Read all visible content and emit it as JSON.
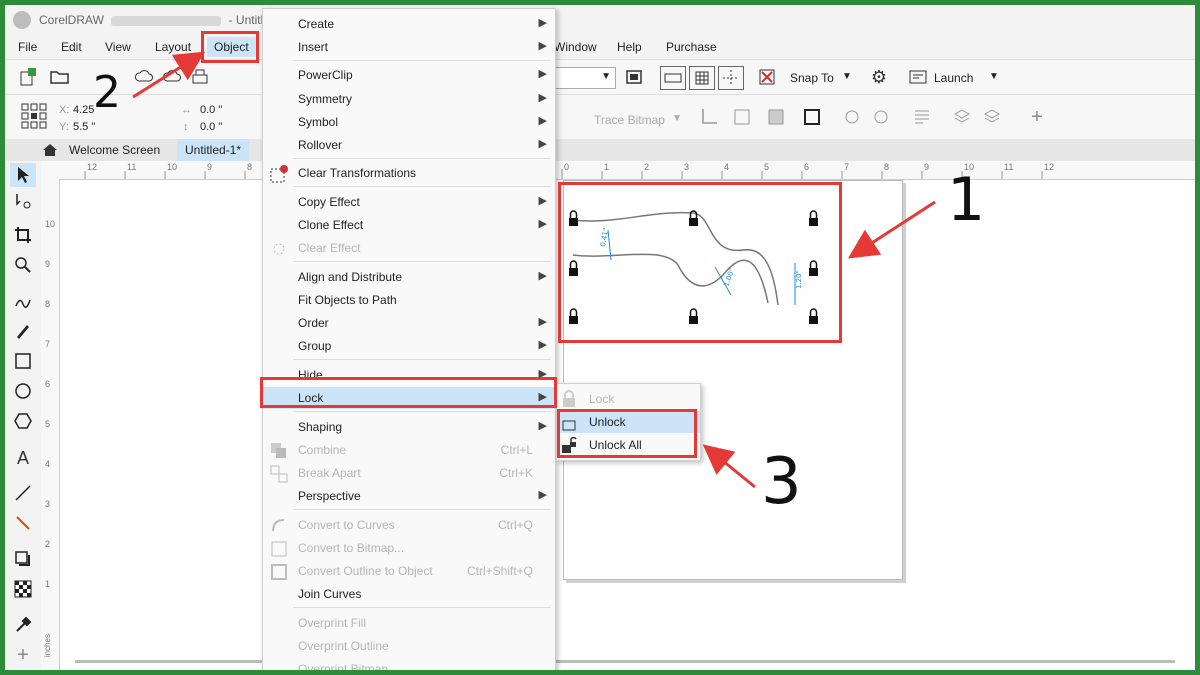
{
  "window": {
    "app_title": "CorelDRAW",
    "title_suffix": "- Untitled"
  },
  "menubar": [
    "File",
    "Edit",
    "View",
    "Layout",
    "Object",
    "Window",
    "Help",
    "Purchase"
  ],
  "toolbar": {
    "snap_to": "Snap To",
    "launch": "Launch",
    "trace_bitmap": "Trace Bitmap"
  },
  "property_bar": {
    "x": "4.25",
    "y": "5.5 \"",
    "w": "0.0 \"",
    "h": "0.0 \""
  },
  "tabs": {
    "welcome": "Welcome Screen",
    "doc": "Untitled-1*"
  },
  "ruler_top_labels": [
    "12",
    "11",
    "10",
    "9",
    "8",
    "0",
    "1",
    "2",
    "3",
    "4",
    "5",
    "6",
    "7",
    "8",
    "9",
    "10",
    "11",
    "12"
  ],
  "ruler_left_labels": [
    "10",
    "9",
    "8",
    "7",
    "6",
    "5",
    "4",
    "3",
    "2",
    "1"
  ],
  "ruler_unit": "inches",
  "object_menu": {
    "create": "Create",
    "insert": "Insert",
    "powerclip": "PowerClip",
    "symmetry": "Symmetry",
    "symbol": "Symbol",
    "rollover": "Rollover",
    "clear_transformations": "Clear Transformations",
    "copy_effect": "Copy Effect",
    "clone_effect": "Clone Effect",
    "clear_effect": "Clear Effect",
    "align": "Align and Distribute",
    "fit_path": "Fit Objects to Path",
    "order": "Order",
    "group": "Group",
    "hide": "Hide",
    "lock": "Lock",
    "shaping": "Shaping",
    "combine": "Combine",
    "combine_sc": "Ctrl+L",
    "break_apart": "Break Apart",
    "break_apart_sc": "Ctrl+K",
    "perspective": "Perspective",
    "convert_curves": "Convert to Curves",
    "convert_curves_sc": "Ctrl+Q",
    "convert_bitmap": "Convert to Bitmap...",
    "convert_outline": "Convert Outline to Object",
    "convert_outline_sc": "Ctrl+Shift+Q",
    "join_curves": "Join Curves",
    "overprint_fill": "Overprint Fill",
    "overprint_outline": "Overprint Outline",
    "overprint_bitmap": "Overprint Bitmap"
  },
  "lock_submenu": {
    "lock": "Lock",
    "unlock": "Unlock",
    "unlock_all": "Unlock All"
  },
  "dimensions": {
    "d1": "0.41\"",
    "d2": "1.00\"",
    "d3": "1.20\""
  },
  "annotations": {
    "one": "1",
    "two": "2",
    "three": "3"
  },
  "colors": {
    "annotation_red": "#e53935",
    "frame_green": "#2e8b3a",
    "highlight": "#cce4f7"
  }
}
